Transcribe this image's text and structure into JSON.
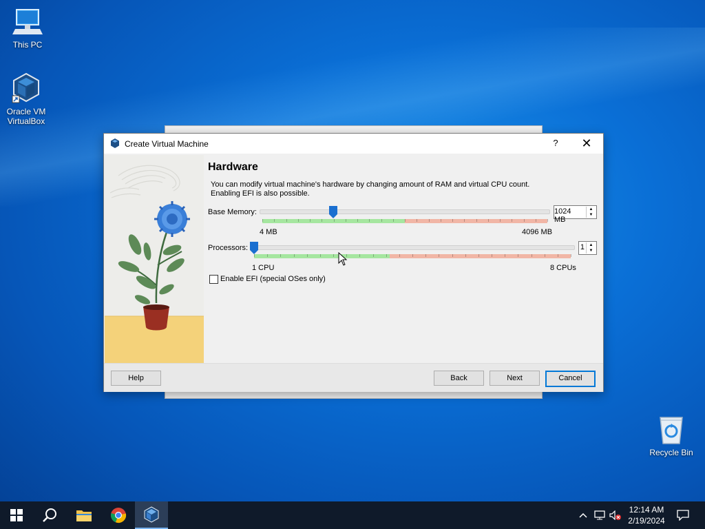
{
  "desktop": {
    "icons": [
      {
        "label": "This PC"
      },
      {
        "label": "Oracle VM VirtualBox"
      },
      {
        "label": "Recycle Bin"
      }
    ]
  },
  "dialog": {
    "title": "Create Virtual Machine",
    "help_glyph": "?",
    "close_glyph": "✕",
    "heading": "Hardware",
    "description_line1": "You can modify virtual machine's hardware by changing amount of RAM and virtual CPU count.",
    "description_line2": "Enabling EFI is also possible.",
    "memory": {
      "label": "Base Memory:",
      "min_label": "4 MB",
      "max_label": "4096 MB",
      "value_text": "1024 MB",
      "value_mb": 1024,
      "min_mb": 4,
      "max_mb": 4096,
      "recommended_max_fraction": 0.5
    },
    "processors": {
      "label": "Processors:",
      "min_label": "1 CPU",
      "max_label": "8 CPUs",
      "value_text": "1",
      "value": 1,
      "min": 1,
      "max": 8,
      "recommended_max_fraction": 0.4286
    },
    "efi": {
      "label": "Enable EFI (special OSes only)",
      "checked": false
    },
    "buttons": {
      "help": "Help",
      "back": "Back",
      "next": "Next",
      "cancel": "Cancel"
    }
  },
  "taskbar": {
    "items": [
      "start-icon",
      "search-icon",
      "file-explorer-icon",
      "chrome-icon",
      "virtualbox-icon"
    ],
    "time": "12:14 AM",
    "date": "2/19/2024"
  },
  "colors": {
    "accent": "#0078d7",
    "scale_green": "#a6e6a0",
    "scale_red": "#f1b6a6",
    "thumb": "#1a6fd0"
  }
}
